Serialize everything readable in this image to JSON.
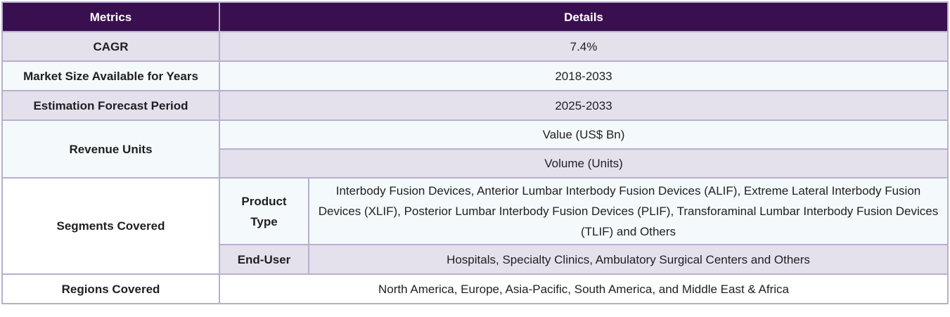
{
  "header": {
    "metrics": "Metrics",
    "details": "Details"
  },
  "rows": {
    "cagr": {
      "label": "CAGR",
      "value": "7.4%"
    },
    "market_size": {
      "label": "Market Size Available for Years",
      "value": "2018-2033"
    },
    "forecast": {
      "label": "Estimation Forecast Period",
      "value": "2025-2033"
    },
    "revenue_units": {
      "label": "Revenue Units",
      "value_1": "Value (US$ Bn)",
      "value_2": "Volume (Units)"
    },
    "segments": {
      "label": "Segments Covered",
      "product_type": {
        "label": "Product Type",
        "value": "Interbody Fusion Devices, Anterior Lumbar Interbody Fusion Devices (ALIF), Extreme Lateral Interbody Fusion Devices (XLIF), Posterior Lumbar Interbody Fusion Devices (PLIF), Transforaminal Lumbar Interbody Fusion Devices (TLIF) and Others"
      },
      "end_user": {
        "label": "End-User",
        "value": "Hospitals, Specialty Clinics, Ambulatory Surgical Centers and Others"
      }
    },
    "regions": {
      "label": "Regions Covered",
      "value": "North America, Europe, Asia-Pacific, South America, and Middle East & Africa"
    }
  },
  "colors": {
    "header_bg": "#3a0f4f",
    "shade_bg": "#e4e0ec",
    "light_bg": "#f4f9fb",
    "border": "#b7afd0"
  }
}
